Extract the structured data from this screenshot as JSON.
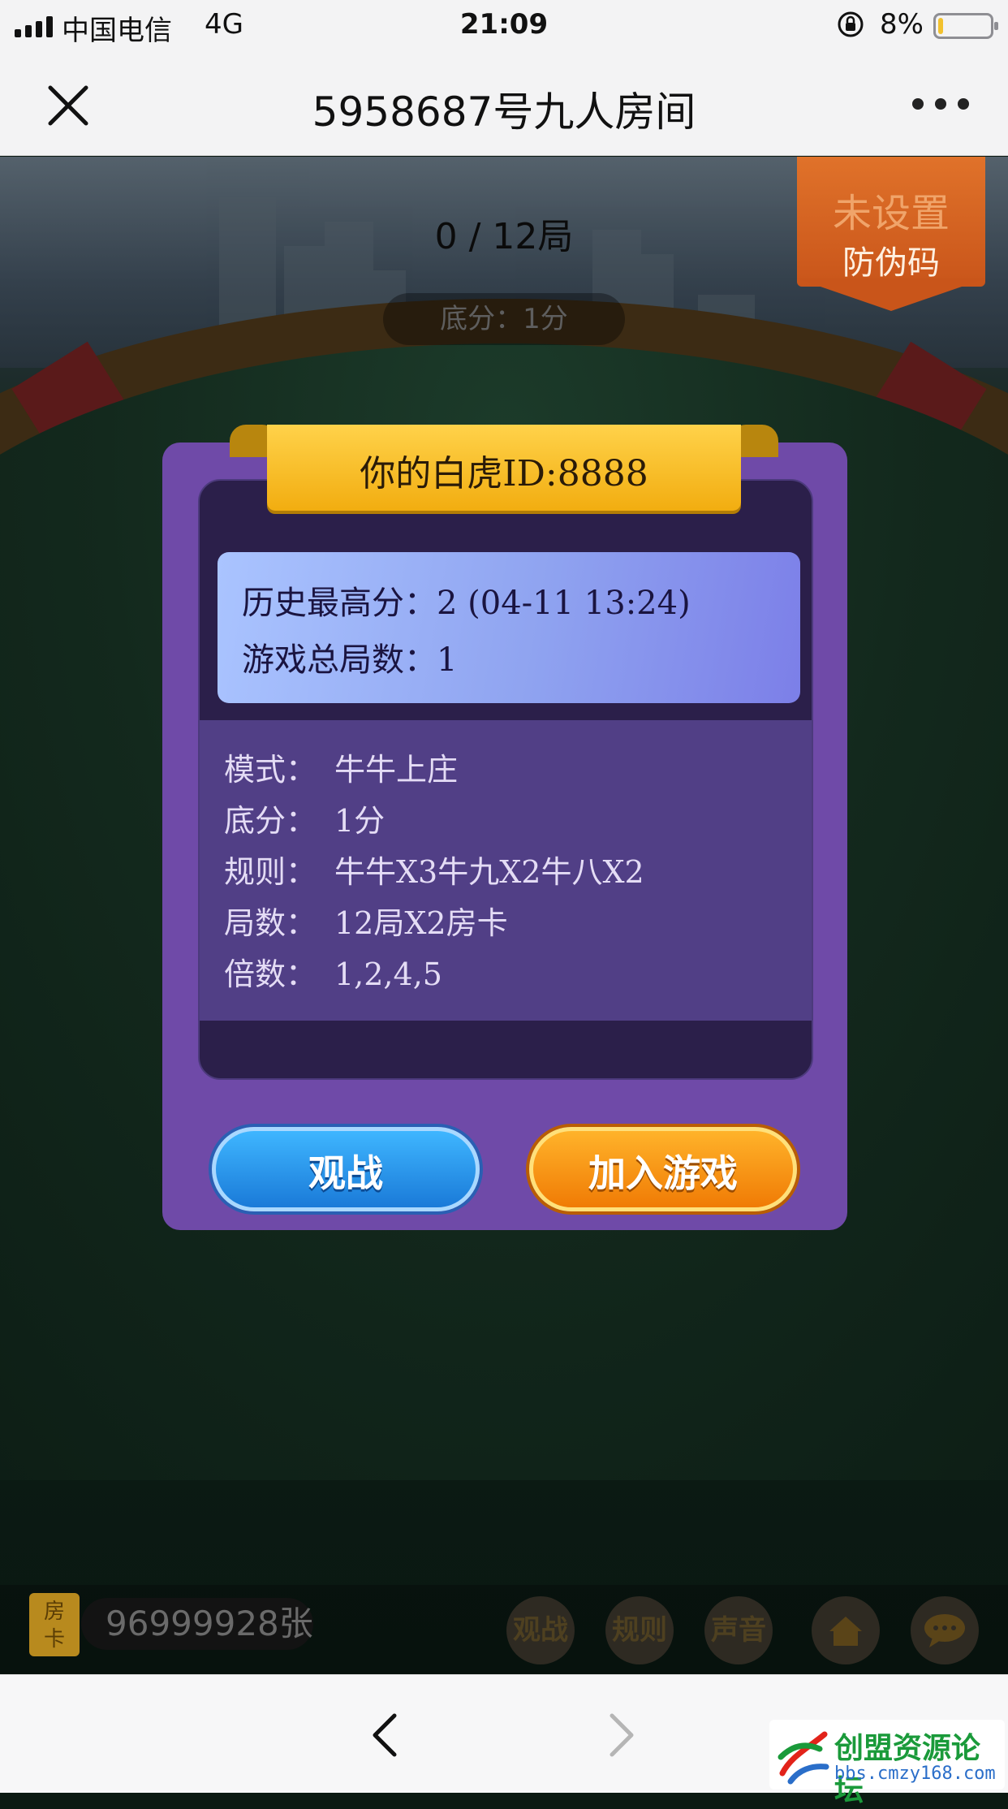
{
  "status_bar": {
    "carrier": "中国电信",
    "network": "4G",
    "time": "21:09",
    "battery_percent": "8%",
    "battery_level": 0.08
  },
  "nav": {
    "title": "5958687号九人房间"
  },
  "game": {
    "round": "0 / 12局",
    "base_score": "底分：1分"
  },
  "badge": {
    "line1": "未设置",
    "line2": "防伪码"
  },
  "dialog": {
    "header": "你的白虎ID:8888",
    "stats": {
      "best_label": "历史最高分：",
      "best_value": "2 (04-11 13:24)",
      "games_label": "游戏总局数：",
      "games_value": "1"
    },
    "info": [
      {
        "label": "模式：",
        "value": "牛牛上庄"
      },
      {
        "label": "底分：",
        "value": "1分"
      },
      {
        "label": "规则：",
        "value": "牛牛X3牛九X2牛八X2"
      },
      {
        "label": "局数：",
        "value": "12局X2房卡"
      },
      {
        "label": "倍数：",
        "value": "1,2,4,5"
      }
    ],
    "watch_button": "观战",
    "join_button": "加入游戏"
  },
  "bottom_bar": {
    "card_icon_text": "房卡",
    "card_count": "96999928张",
    "buttons": [
      "观战",
      "规则",
      "声音"
    ]
  },
  "watermark": {
    "name": "创盟资源论坛",
    "url": "bbs.cmzy168.com"
  },
  "colors": {
    "dialog": "#6f4aa8",
    "watch_button": "#1a7ad8",
    "join_button": "#f07b05",
    "badge": "#d5621f"
  }
}
